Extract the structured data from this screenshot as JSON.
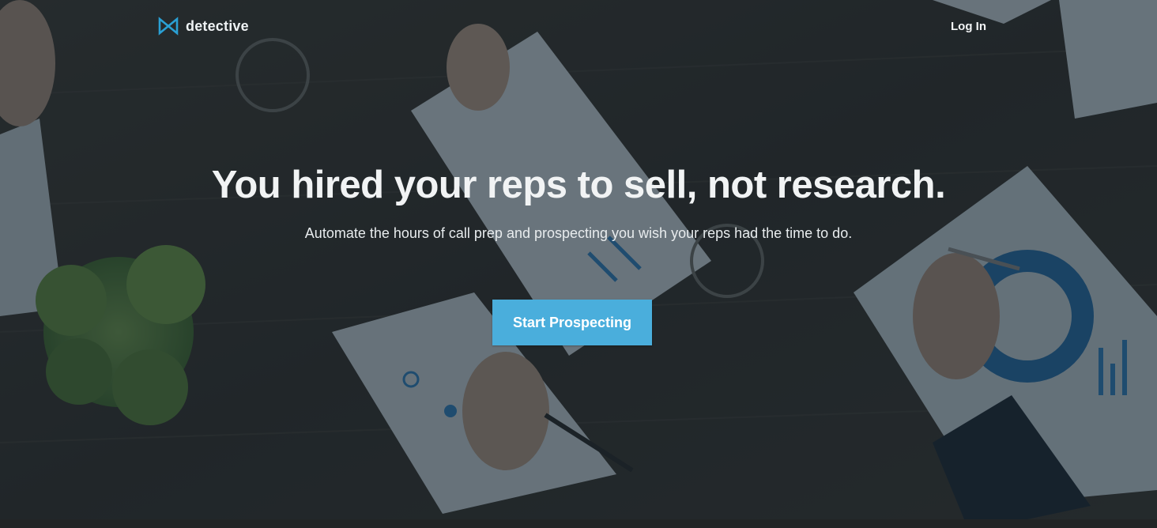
{
  "brand": {
    "name": "detective",
    "logo_icon": "bowtie-logo-icon",
    "accent_color": "#2aa0d4"
  },
  "nav": {
    "login_label": "Log In"
  },
  "hero": {
    "headline": "You hired your reps to sell, not research.",
    "subheadline": "Automate the hours of call prep and prospecting you wish your reps had the time to do.",
    "cta_label": "Start Prospecting",
    "cta_color": "#4aaedc",
    "background_image": "desk-with-documents-and-hands-photo"
  }
}
